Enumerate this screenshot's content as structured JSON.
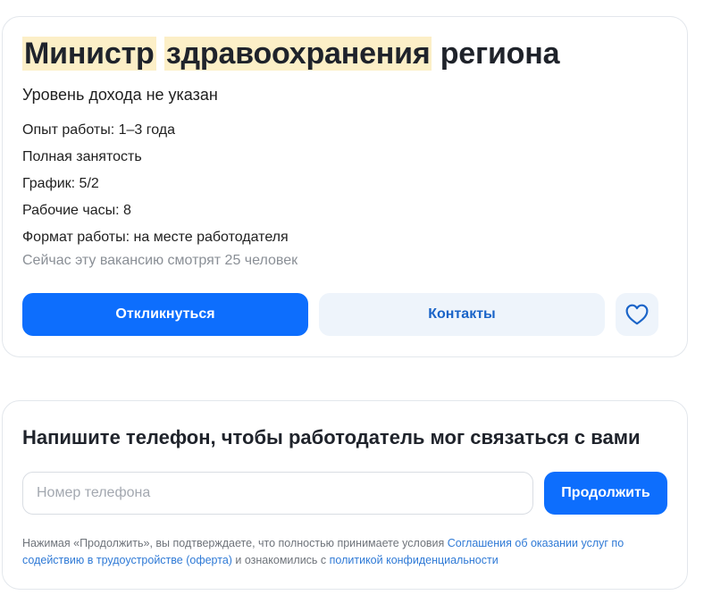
{
  "vacancy": {
    "title_words": [
      "Министр",
      "здравоохранения",
      "региона"
    ],
    "salary": "Уровень дохода не указан",
    "details": [
      "Опыт работы: 1–3 года",
      "Полная занятость",
      "График: 5/2",
      "Рабочие часы: 8",
      "Формат работы: на месте работодателя"
    ],
    "viewers": "Сейчас эту вакансию смотрят 25 человек",
    "respond_label": "Откликнуться",
    "contacts_label": "Контакты",
    "favorite_icon": "heart-icon"
  },
  "phone_form": {
    "title": "Напишите телефон, чтобы работодатель мог связаться с вами",
    "placeholder": "Номер телефона",
    "value": "",
    "continue_label": "Продолжить",
    "consent_prefix": "Нажимая «Продолжить», вы подтверждаете, что полностью принимаете условия ",
    "consent_link1": "Соглашения об оказании услуг по содействию в трудоустройстве (оферта)",
    "consent_middle": " и ознакомились с ",
    "consent_link2": "политикой конфиденциальности"
  },
  "colors": {
    "primary": "#0d6efd",
    "secondary_bg": "#eef4fb",
    "secondary_text": "#1a64c8",
    "highlight": "#fcefc7",
    "muted": "#8a8f96",
    "link": "#2f7ad6"
  }
}
